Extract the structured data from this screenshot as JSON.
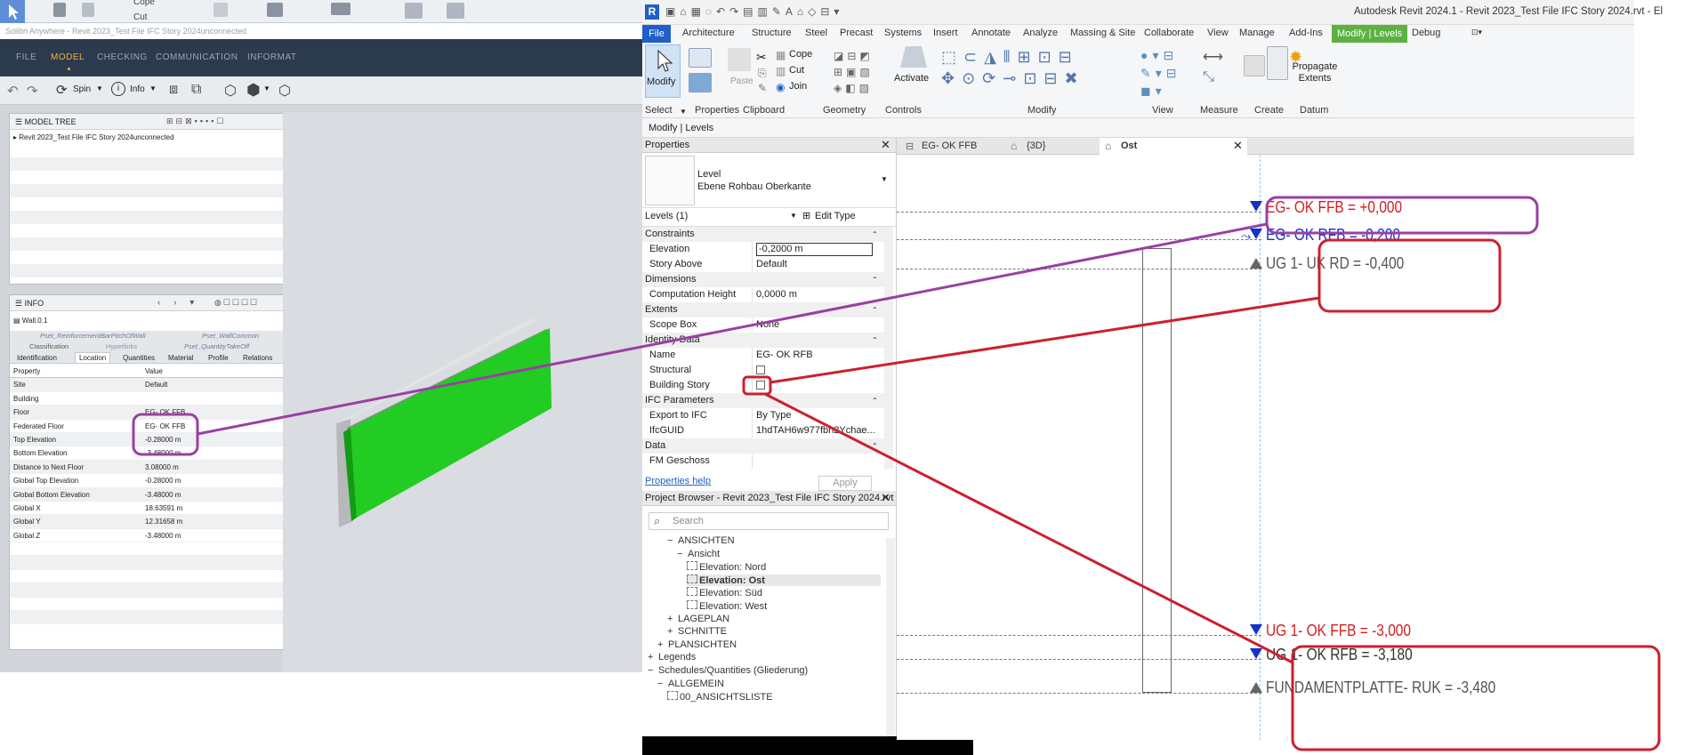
{
  "solibri": {
    "window_title": "Solibri Anywhere - Revit 2023_Test File IFC Story 2024unconnected",
    "qat": {
      "cope": "Cope",
      "cut": "Cut"
    },
    "menu": [
      "FILE",
      "MODEL",
      "CHECKING",
      "COMMUNICATION",
      "INFORMAT"
    ],
    "active_menu": "MODEL",
    "toolbar": {
      "spin": "Spin",
      "info": "Info"
    },
    "model_tree": {
      "title": "MODEL TREE",
      "root": "Revit 2023_Test File IFC Story 2024unconnected"
    },
    "info": {
      "title": "INFO",
      "element": "Wall.0.1",
      "tabs_row1": [
        "Pset_ReinforcementBarPitchOfWall",
        "Pset_WallCommon"
      ],
      "tabs_row2": [
        "Classification",
        "Hyperlinks",
        "Pset_QuantityTakeOff"
      ],
      "tabs_row3": [
        "Identification",
        "Location",
        "Quantities",
        "Material",
        "Profile",
        "Relations"
      ],
      "active_tab": "Location",
      "columns": [
        "Property",
        "Value"
      ],
      "rows": [
        {
          "p": "Site",
          "v": "Default"
        },
        {
          "p": "Building",
          "v": ""
        },
        {
          "p": "Floor",
          "v": "EG- OK FFB"
        },
        {
          "p": "Federated Floor",
          "v": "EG- OK FFB"
        },
        {
          "p": "Top Elevation",
          "v": "-0.28000 m"
        },
        {
          "p": "Bottom Elevation",
          "v": "-3.48000 m"
        },
        {
          "p": "Distance to Next Floor",
          "v": "3.08000 m"
        },
        {
          "p": "Global Top Elevation",
          "v": "-0.28000 m"
        },
        {
          "p": "Global Bottom Elevation",
          "v": "-3.48000 m"
        },
        {
          "p": "Global X",
          "v": "18.63591 m"
        },
        {
          "p": "Global Y",
          "v": "12.31658 m"
        },
        {
          "p": "Global Z",
          "v": "-3.48000 m"
        }
      ]
    },
    "colors": {
      "menu_bg": "#2c3a4d",
      "accent": "#f1b23c",
      "wall": "#22cc22"
    }
  },
  "revit": {
    "title": "Autodesk Revit 2024.1 - Revit 2023_Test File IFC Story 2024.rvt - El",
    "tabs": [
      "File",
      "Architecture",
      "Structure",
      "Steel",
      "Precast",
      "Systems",
      "Insert",
      "Annotate",
      "Analyze",
      "Massing & Site",
      "Collaborate",
      "View",
      "Manage",
      "Add-Ins",
      "Modify | Levels",
      "Debug"
    ],
    "ribbon": {
      "modify": "Modify",
      "paste": "Paste",
      "cope": "Cope",
      "cut": "Cut",
      "join": "Join",
      "activate": "Activate",
      "propagate": "Propagate Extents",
      "groups": [
        "Select",
        "Properties",
        "Clipboard",
        "Geometry",
        "Controls",
        "Modify",
        "View",
        "Measure",
        "Create",
        "Datum"
      ]
    },
    "context_bar": "Modify | Levels",
    "properties": {
      "title": "Properties",
      "type_family": "Level",
      "type_name": "Ebene Rohbau Oberkante",
      "selector": "Levels (1)",
      "edit_type": "Edit Type",
      "rows": [
        {
          "group": "Constraints"
        },
        {
          "n": "Elevation",
          "v": "-0,2000 m",
          "input": true
        },
        {
          "n": "Story Above",
          "v": "Default"
        },
        {
          "group": "Dimensions"
        },
        {
          "n": "Computation Height",
          "v": "0,0000 m"
        },
        {
          "group": "Extents"
        },
        {
          "n": "Scope Box",
          "v": "None"
        },
        {
          "group": "Identity Data"
        },
        {
          "n": "Name",
          "v": "EG- OK RFB"
        },
        {
          "n": "Structural",
          "v": "",
          "check": true
        },
        {
          "n": "Building Story",
          "v": "",
          "check": true
        },
        {
          "group": "IFC Parameters"
        },
        {
          "n": "Export to IFC",
          "v": "By Type"
        },
        {
          "n": "IfcGUID",
          "v": "1hdTAH6w977fbn2Ychae..."
        },
        {
          "group": "Data"
        },
        {
          "n": "FM Geschoss",
          "v": ""
        }
      ],
      "help": "Properties help",
      "apply": "Apply"
    },
    "browser": {
      "title": "Project Browser - Revit 2023_Test File IFC Story 2024.rvt",
      "search": "Search",
      "items": [
        {
          "t": "ANSICHTEN",
          "lvl": 2,
          "sign": "−"
        },
        {
          "t": "Ansicht",
          "lvl": 3,
          "sign": "−"
        },
        {
          "t": "Elevation: Nord",
          "lvl": 4
        },
        {
          "t": "Elevation: Ost",
          "lvl": 4,
          "bold": true
        },
        {
          "t": "Elevation: Süd",
          "lvl": 4
        },
        {
          "t": "Elevation: West",
          "lvl": 4
        },
        {
          "t": "LAGEPLAN",
          "lvl": 2,
          "sign": "+"
        },
        {
          "t": "SCHNITTE",
          "lvl": 2,
          "sign": "+"
        },
        {
          "t": "PLANSICHTEN",
          "lvl": 1,
          "sign": "+"
        },
        {
          "t": "Legends",
          "lvl": 0,
          "sign": "+"
        },
        {
          "t": "Schedules/Quantities (Gliederung)",
          "lvl": 0,
          "sign": "−"
        },
        {
          "t": "ALLGEMEIN",
          "lvl": 1,
          "sign": "−"
        },
        {
          "t": "00_ANSICHTSLISTE",
          "lvl": 2
        }
      ]
    },
    "view_tabs": [
      "EG- OK FFB",
      "{3D}",
      "Ost"
    ],
    "active_view": "Ost",
    "levels": [
      {
        "name": "EG- OK FFB",
        "value": "+0,000",
        "color": "#d42020"
      },
      {
        "name": "EG- OK RFB",
        "value": "-0,200",
        "color": "#1630c8"
      },
      {
        "name": "UG 1- UK RD",
        "value": "-0,400",
        "color": "#555555"
      },
      {
        "name": "UG 1- OK FFB",
        "value": "-3,000",
        "color": "#d42020"
      },
      {
        "name": "UG 1- OK RFB",
        "value": "-3,180",
        "color": "#333333"
      },
      {
        "name": "FUNDAMENTPLATTE- RUK",
        "value": "-3,480",
        "color": "#555555"
      }
    ],
    "colors": {
      "file_tab": "#1f5fc7",
      "context_tab": "#5db143",
      "annotation_red": "#cc1f2f",
      "annotation_purple": "#9a3fa3"
    }
  }
}
